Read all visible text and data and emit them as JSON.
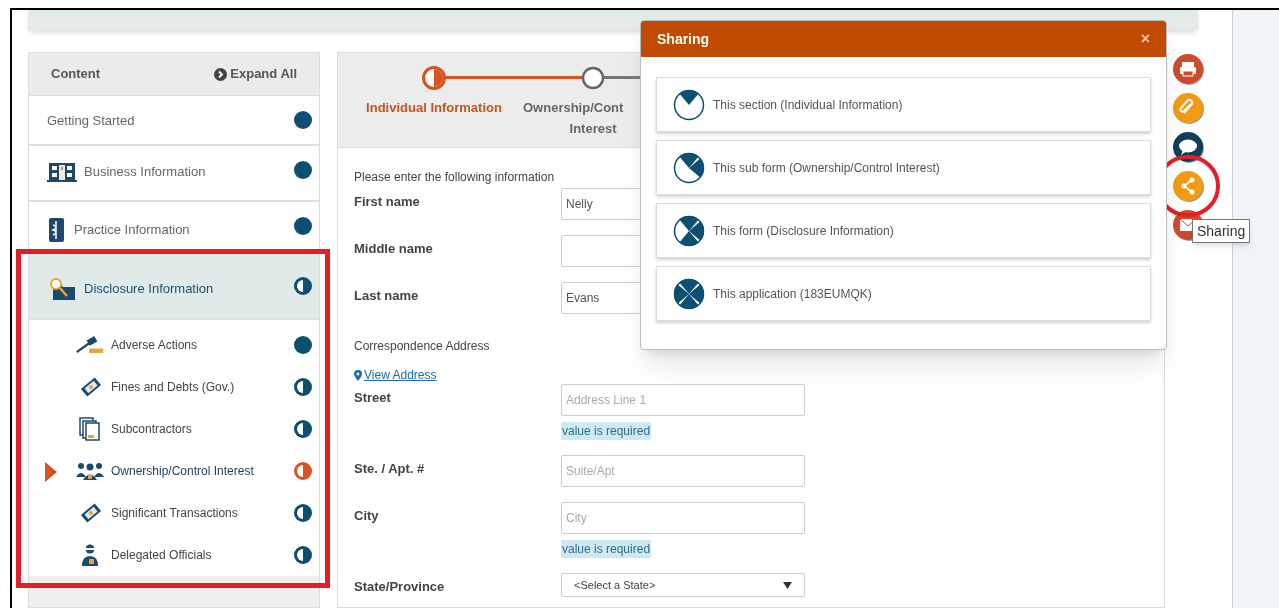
{
  "sidebar": {
    "title": "Content",
    "expand_all": "Expand All",
    "items": [
      {
        "label": "Getting Started",
        "complete": true,
        "selected": false,
        "annotated": false
      },
      {
        "label": "Business Information",
        "complete": true,
        "selected": false,
        "annotated": false
      },
      {
        "label": "Practice Information",
        "complete": true,
        "selected": false,
        "annotated": false
      },
      {
        "label": "Disclosure Information",
        "complete": false,
        "selected": true,
        "annotated": true,
        "children": [
          {
            "label": "Adverse Actions",
            "complete": true,
            "selected": false
          },
          {
            "label": "Fines and Debts (Gov.)",
            "complete": false,
            "selected": false
          },
          {
            "label": "Subcontractors",
            "complete": false,
            "selected": false
          },
          {
            "label": "Ownership/Control Interest",
            "complete": false,
            "selected": true
          },
          {
            "label": "Significant Transactions",
            "complete": false,
            "selected": false
          },
          {
            "label": "Delegated Officials",
            "complete": false,
            "selected": false
          }
        ]
      }
    ]
  },
  "form": {
    "steps": [
      {
        "lines": [
          "Individual Information"
        ],
        "current": true
      },
      {
        "lines": [
          "Ownership/Cont",
          "Interest"
        ],
        "current": false
      }
    ],
    "intro": "Please enter the following information",
    "rows": [
      {
        "kind": "input",
        "label": "First name",
        "value": "Nelly"
      },
      {
        "kind": "input",
        "label": "Middle name"
      },
      {
        "kind": "input",
        "label": "Last name",
        "value": "Evans"
      },
      {
        "kind": "heading",
        "label": "Correspondence Address"
      },
      {
        "kind": "link",
        "label": "View Address"
      },
      {
        "kind": "input",
        "label": "Street",
        "placeholder": "Address Line 1",
        "message": "value is required"
      },
      {
        "kind": "input",
        "label": "Ste. / Apt. #",
        "placeholder": "Suite/Apt"
      },
      {
        "kind": "input",
        "label": "City",
        "placeholder": "City",
        "message": "value is required"
      },
      {
        "kind": "select",
        "label": "State/Province",
        "value": "<Select a State>"
      }
    ]
  },
  "sharing": {
    "title": "Sharing",
    "close": "×",
    "options": [
      {
        "label": "This section (Individual Information)",
        "kind": "section"
      },
      {
        "label": "This sub form (Ownership/Control Interest)",
        "kind": "subform"
      },
      {
        "label": "This form (Disclosure Information)",
        "kind": "form"
      },
      {
        "label": "This application (183EUMQK)",
        "kind": "application"
      }
    ]
  },
  "tools": [
    {
      "kind": "print",
      "circled": false
    },
    {
      "kind": "attach",
      "circled": false
    },
    {
      "kind": "comment",
      "circled": false
    },
    {
      "kind": "share",
      "circled": true
    },
    {
      "kind": "email",
      "circled": false
    }
  ],
  "tooltip": "Sharing"
}
